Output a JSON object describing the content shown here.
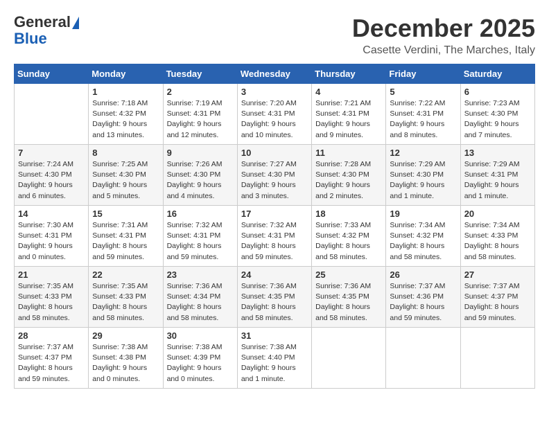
{
  "header": {
    "logo_line1": "General",
    "logo_line2": "Blue",
    "month": "December 2025",
    "location": "Casette Verdini, The Marches, Italy"
  },
  "weekdays": [
    "Sunday",
    "Monday",
    "Tuesday",
    "Wednesday",
    "Thursday",
    "Friday",
    "Saturday"
  ],
  "weeks": [
    [
      {
        "day": "",
        "info": ""
      },
      {
        "day": "1",
        "info": "Sunrise: 7:18 AM\nSunset: 4:32 PM\nDaylight: 9 hours\nand 13 minutes."
      },
      {
        "day": "2",
        "info": "Sunrise: 7:19 AM\nSunset: 4:31 PM\nDaylight: 9 hours\nand 12 minutes."
      },
      {
        "day": "3",
        "info": "Sunrise: 7:20 AM\nSunset: 4:31 PM\nDaylight: 9 hours\nand 10 minutes."
      },
      {
        "day": "4",
        "info": "Sunrise: 7:21 AM\nSunset: 4:31 PM\nDaylight: 9 hours\nand 9 minutes."
      },
      {
        "day": "5",
        "info": "Sunrise: 7:22 AM\nSunset: 4:31 PM\nDaylight: 9 hours\nand 8 minutes."
      },
      {
        "day": "6",
        "info": "Sunrise: 7:23 AM\nSunset: 4:30 PM\nDaylight: 9 hours\nand 7 minutes."
      }
    ],
    [
      {
        "day": "7",
        "info": "Sunrise: 7:24 AM\nSunset: 4:30 PM\nDaylight: 9 hours\nand 6 minutes."
      },
      {
        "day": "8",
        "info": "Sunrise: 7:25 AM\nSunset: 4:30 PM\nDaylight: 9 hours\nand 5 minutes."
      },
      {
        "day": "9",
        "info": "Sunrise: 7:26 AM\nSunset: 4:30 PM\nDaylight: 9 hours\nand 4 minutes."
      },
      {
        "day": "10",
        "info": "Sunrise: 7:27 AM\nSunset: 4:30 PM\nDaylight: 9 hours\nand 3 minutes."
      },
      {
        "day": "11",
        "info": "Sunrise: 7:28 AM\nSunset: 4:30 PM\nDaylight: 9 hours\nand 2 minutes."
      },
      {
        "day": "12",
        "info": "Sunrise: 7:29 AM\nSunset: 4:30 PM\nDaylight: 9 hours\nand 1 minute."
      },
      {
        "day": "13",
        "info": "Sunrise: 7:29 AM\nSunset: 4:31 PM\nDaylight: 9 hours\nand 1 minute."
      }
    ],
    [
      {
        "day": "14",
        "info": "Sunrise: 7:30 AM\nSunset: 4:31 PM\nDaylight: 9 hours\nand 0 minutes."
      },
      {
        "day": "15",
        "info": "Sunrise: 7:31 AM\nSunset: 4:31 PM\nDaylight: 8 hours\nand 59 minutes."
      },
      {
        "day": "16",
        "info": "Sunrise: 7:32 AM\nSunset: 4:31 PM\nDaylight: 8 hours\nand 59 minutes."
      },
      {
        "day": "17",
        "info": "Sunrise: 7:32 AM\nSunset: 4:31 PM\nDaylight: 8 hours\nand 59 minutes."
      },
      {
        "day": "18",
        "info": "Sunrise: 7:33 AM\nSunset: 4:32 PM\nDaylight: 8 hours\nand 58 minutes."
      },
      {
        "day": "19",
        "info": "Sunrise: 7:34 AM\nSunset: 4:32 PM\nDaylight: 8 hours\nand 58 minutes."
      },
      {
        "day": "20",
        "info": "Sunrise: 7:34 AM\nSunset: 4:33 PM\nDaylight: 8 hours\nand 58 minutes."
      }
    ],
    [
      {
        "day": "21",
        "info": "Sunrise: 7:35 AM\nSunset: 4:33 PM\nDaylight: 8 hours\nand 58 minutes."
      },
      {
        "day": "22",
        "info": "Sunrise: 7:35 AM\nSunset: 4:33 PM\nDaylight: 8 hours\nand 58 minutes."
      },
      {
        "day": "23",
        "info": "Sunrise: 7:36 AM\nSunset: 4:34 PM\nDaylight: 8 hours\nand 58 minutes."
      },
      {
        "day": "24",
        "info": "Sunrise: 7:36 AM\nSunset: 4:35 PM\nDaylight: 8 hours\nand 58 minutes."
      },
      {
        "day": "25",
        "info": "Sunrise: 7:36 AM\nSunset: 4:35 PM\nDaylight: 8 hours\nand 58 minutes."
      },
      {
        "day": "26",
        "info": "Sunrise: 7:37 AM\nSunset: 4:36 PM\nDaylight: 8 hours\nand 59 minutes."
      },
      {
        "day": "27",
        "info": "Sunrise: 7:37 AM\nSunset: 4:37 PM\nDaylight: 8 hours\nand 59 minutes."
      }
    ],
    [
      {
        "day": "28",
        "info": "Sunrise: 7:37 AM\nSunset: 4:37 PM\nDaylight: 8 hours\nand 59 minutes."
      },
      {
        "day": "29",
        "info": "Sunrise: 7:38 AM\nSunset: 4:38 PM\nDaylight: 9 hours\nand 0 minutes."
      },
      {
        "day": "30",
        "info": "Sunrise: 7:38 AM\nSunset: 4:39 PM\nDaylight: 9 hours\nand 0 minutes."
      },
      {
        "day": "31",
        "info": "Sunrise: 7:38 AM\nSunset: 4:40 PM\nDaylight: 9 hours\nand 1 minute."
      },
      {
        "day": "",
        "info": ""
      },
      {
        "day": "",
        "info": ""
      },
      {
        "day": "",
        "info": ""
      }
    ]
  ]
}
